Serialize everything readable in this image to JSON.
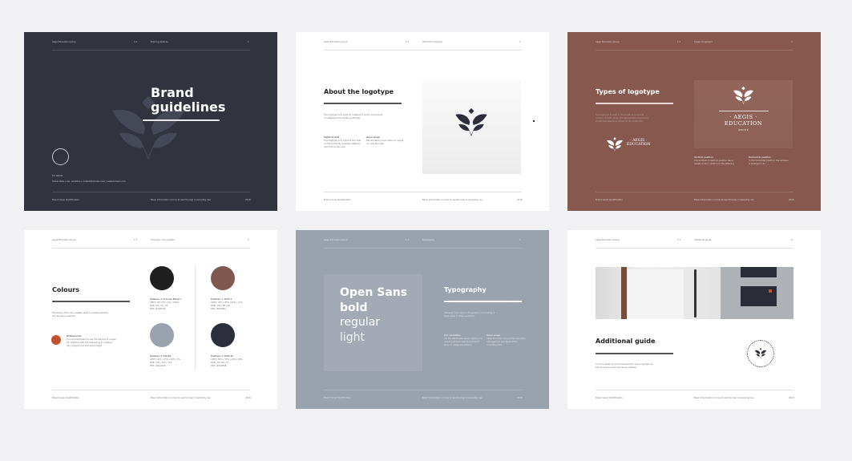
{
  "common": {
    "company": "Aegis Education Group",
    "footer_left": "Brand visual identification",
    "footer_mid": "Basic information on how to use the logo in everyday use",
    "year": "2018"
  },
  "slides": [
    {
      "section": "1.0",
      "header": "Brand guidelines",
      "page": "1",
      "title_line1": "Brand",
      "title_line2": "guidelines",
      "contact_label": "For details",
      "contact": "Tomas Ross | ceo: Aristotos  |  contact@domain.com  |  www.domain.com"
    },
    {
      "section": "1.1",
      "header": "About the logotype",
      "page": "2",
      "title": "About the logotype",
      "intro": [
        "The logotype is a mystical creature of a bird reminiscent",
        "of creatures from Greek mythology"
      ],
      "col1_title": "Mythical bird",
      "col1": [
        "The logotype is a mythical bird that",
        "contains friendly qualities. Reflects",
        "until the human soul"
      ],
      "col2_title": "Open wings",
      "col2": [
        "We are taking care under our wings",
        "you will feel safe"
      ]
    },
    {
      "section": "1.2",
      "header": "Types of logotype",
      "page": "3",
      "title": "Types of logotype",
      "intro": [
        "The logotype is used in horizontal and vertical",
        "version. In both cases, the appropriate proportions",
        "of size and spaces as shown in the illustration"
      ],
      "brand_name": "· AEGIS ·",
      "brand_sub": "EDUCATION",
      "brand_group": "GROUP",
      "col1_title": "Vertical position",
      "col1": [
        "The emblem in vertical position has a",
        "height of 3x in relation to the lettering"
      ],
      "col2_title": "Horizontal position",
      "col2": [
        "In the horizontal position, the emblem",
        "is enlarged 1.3x"
      ]
    },
    {
      "section": "1.3",
      "header": "The basic color palette",
      "page": "4",
      "title": "Colours",
      "intro": [
        "The basis of the color palette used to create branding",
        "and printing materials"
      ],
      "note_title": "Refinements",
      "note": [
        "It is recommended to use the refining of copper",
        "foil together with the embossing to create a",
        "very elegant and exclusive image"
      ],
      "swatches": [
        {
          "name": "Pantone ® Process Black C",
          "cmyk": "CMYK: 0% | 0% | 0% | 100%",
          "rgb": "RGB: 29 | 31 | 32",
          "hex": "HEX: #1D1F20",
          "color": "#1f1f20"
        },
        {
          "name": "Pantone ® 4515 C",
          "cmyk": "CMYK: 32% | 65% | 64% | 21%",
          "rgb": "RGB: 130 | 88 | 81",
          "hex": "HEX: #825851",
          "color": "#80584f"
        },
        {
          "name": "Pantone ® 536 EC",
          "cmyk": "CMYK: 40% | 25% | 20% | 3%",
          "rgb": "RGB: 154 | 162 | 174",
          "hex": "HEX: #9AA2AE",
          "color": "#9aa2ae"
        },
        {
          "name": "Pantone ® 5395 EC",
          "cmyk": "CMYK: 83% | 53% | 40% | 63%",
          "rgb": "RGB: 36 | 39 | 47",
          "hex": "HEX: #2C2E3B",
          "color": "#2c2e3b"
        }
      ],
      "accent": "#c4502e"
    },
    {
      "section": "1.4",
      "header": "Typography",
      "page": "5",
      "font_lines": [
        "Open Sans",
        "bold",
        "regular",
        "light"
      ],
      "title": "Typography",
      "intro": [
        "The basic font used in the graphic or branding is",
        "Open Sans in three variations"
      ],
      "col1_title": "Our variations",
      "col1": [
        "We are passionate about helping our",
        "clients put their best foot forward",
        "when it comes promotions"
      ],
      "col2_title": "Open wings",
      "col2": [
        "Aegis Education Group first education",
        "management and application",
        "consulting firm"
      ]
    },
    {
      "section": "1.5",
      "header": "Additional guide",
      "page": "6",
      "title": "Additional guide",
      "intro": [
        "In some cases, it is recommended to use a logotype as",
        "the circle which also serves as a stamp"
      ]
    }
  ]
}
